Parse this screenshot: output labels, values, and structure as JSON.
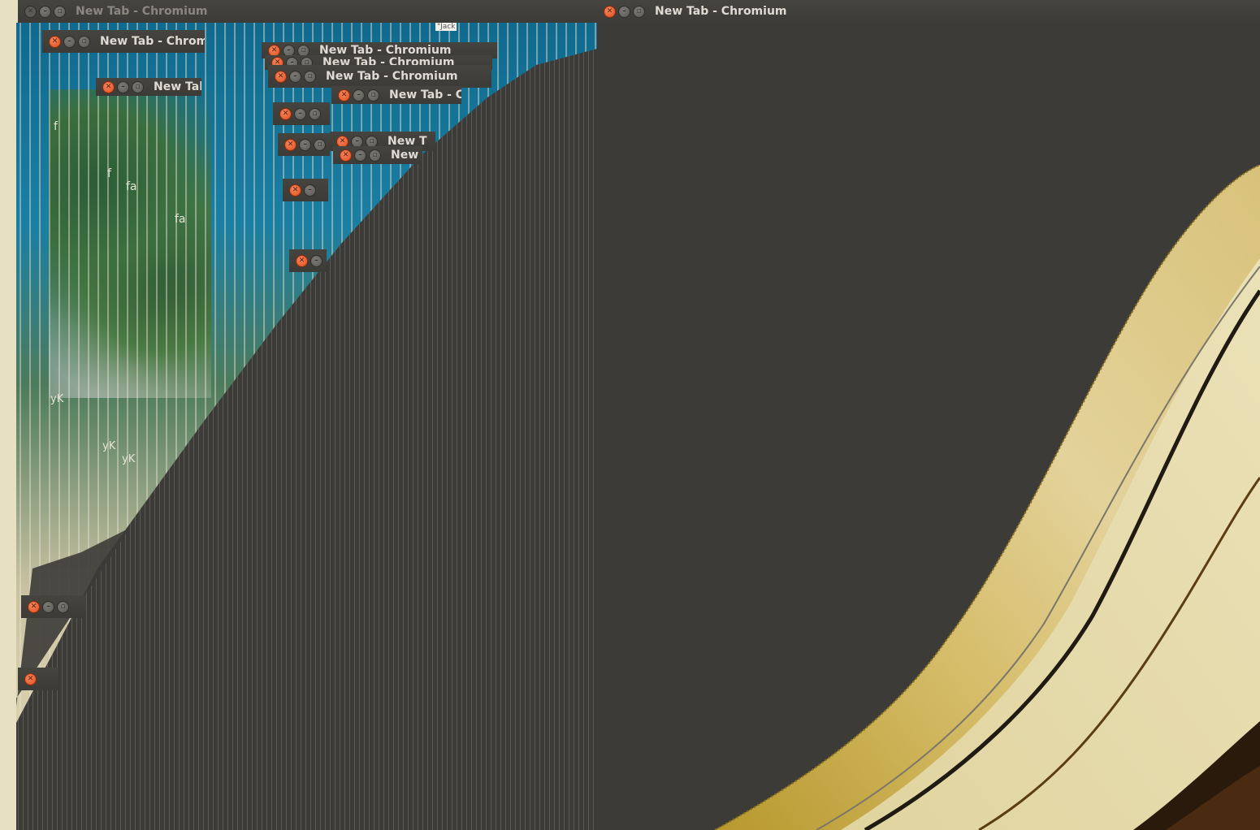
{
  "windows": {
    "main": {
      "title": "New Tab - Chromium",
      "active": true
    },
    "left_top": {
      "title": "New Tab - Chromium",
      "active": false
    }
  },
  "trail_windows": {
    "w1": {
      "title": "New Tab - Chrom"
    },
    "w2": {
      "title": "New Tab - Chromium"
    },
    "w3": {
      "title": "New Tab - Chromium"
    },
    "w4": {
      "title": "New Tab - Chromium"
    },
    "w5": {
      "title": "New Tab"
    },
    "w6": {
      "title": "New Tab - C"
    },
    "w7": {
      "title": "New T"
    },
    "w8": {
      "title": "New"
    }
  },
  "wallpaper_fragments": {
    "f1": "f",
    "f2": "f",
    "f3": "fa",
    "f4": "fa",
    "y1": "yK",
    "y2": "yK",
    "y3": "yK",
    "jack": "\"Jack"
  },
  "buttons": {
    "close_glyph": "✕",
    "min_glyph": "–",
    "max_glyph": "▫"
  },
  "colors": {
    "titlebar": "#3c3b37",
    "close": "#df4b1a",
    "title_text": "#dfdbd2",
    "wallpaper_gold": "#d8c27a"
  }
}
